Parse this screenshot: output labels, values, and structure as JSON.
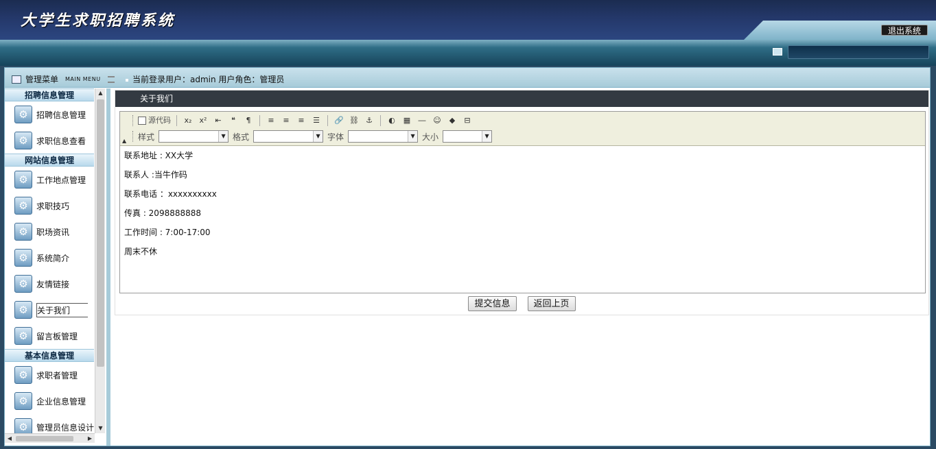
{
  "app": {
    "title": "大学生求职招聘系统",
    "logout_label": "退出系统"
  },
  "menu": {
    "title": "管理菜单",
    "title_en": "MAIN MENU"
  },
  "user": {
    "info": "当前登录用户：admin  用户角色：管理员"
  },
  "sidebar": {
    "categories": [
      {
        "label": "招聘信息管理",
        "items": [
          "招聘信息管理",
          "求职信息查看"
        ]
      },
      {
        "label": "网站信息管理",
        "items": [
          "工作地点管理",
          "求职技巧",
          "职场资讯",
          "系统简介",
          "友情链接",
          "关于我们",
          "留言板管理"
        ]
      },
      {
        "label": "基本信息管理",
        "items": [
          "求职者管理",
          "企业信息管理",
          "管理员信息设计"
        ]
      }
    ],
    "active_item": "关于我们"
  },
  "content": {
    "title": "关于我们",
    "toolbar": {
      "source_label": "源代码",
      "style_label": "样式",
      "format_label": "格式",
      "font_label": "字体",
      "size_label": "大小"
    },
    "body": [
      "联系地址 : XX大学",
      "联系人 :当牛作码",
      "联系电话 ：xxxxxxxxxx",
      "传真 : 2098888888",
      "工作时间 : 7:00-17:00",
      "周末不休"
    ],
    "submit_label": "提交信息",
    "back_label": "返回上页"
  }
}
